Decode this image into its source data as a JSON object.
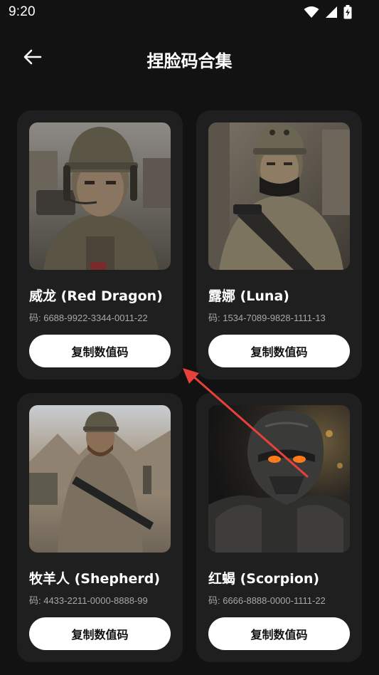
{
  "status_bar": {
    "time": "9:20",
    "icons": [
      "wifi-icon",
      "cellular-signal-icon",
      "battery-charging-icon"
    ]
  },
  "header": {
    "back_icon": "arrow-left-icon",
    "title": "捏脸码合集"
  },
  "cards": [
    {
      "name": "威龙 (Red Dragon)",
      "code": "码: 6688-9922-3344-0011-22",
      "button_label": "复制数值码",
      "image": "soldier-helmet-headset-portrait"
    },
    {
      "name": "露娜 (Luna)",
      "code": "码: 1534-7089-9828-1111-13",
      "button_label": "复制数值码",
      "image": "female-soldier-rifle-portrait"
    },
    {
      "name": "牧羊人 (Shepherd)",
      "code": "码: 4433-2211-0000-8888-99",
      "button_label": "复制数值码",
      "image": "bearded-soldier-desert-rifle"
    },
    {
      "name": "红蝎 (Scorpion)",
      "code": "码: 6666-8888-0000-1111-22",
      "button_label": "复制数值码",
      "image": "armored-mask-glowing-eyes"
    }
  ],
  "colors": {
    "background": "#121212",
    "card": "#1f1f1f",
    "button": "#ffffff",
    "code_text": "#a8a8a8",
    "annotation": "#e8413c"
  }
}
